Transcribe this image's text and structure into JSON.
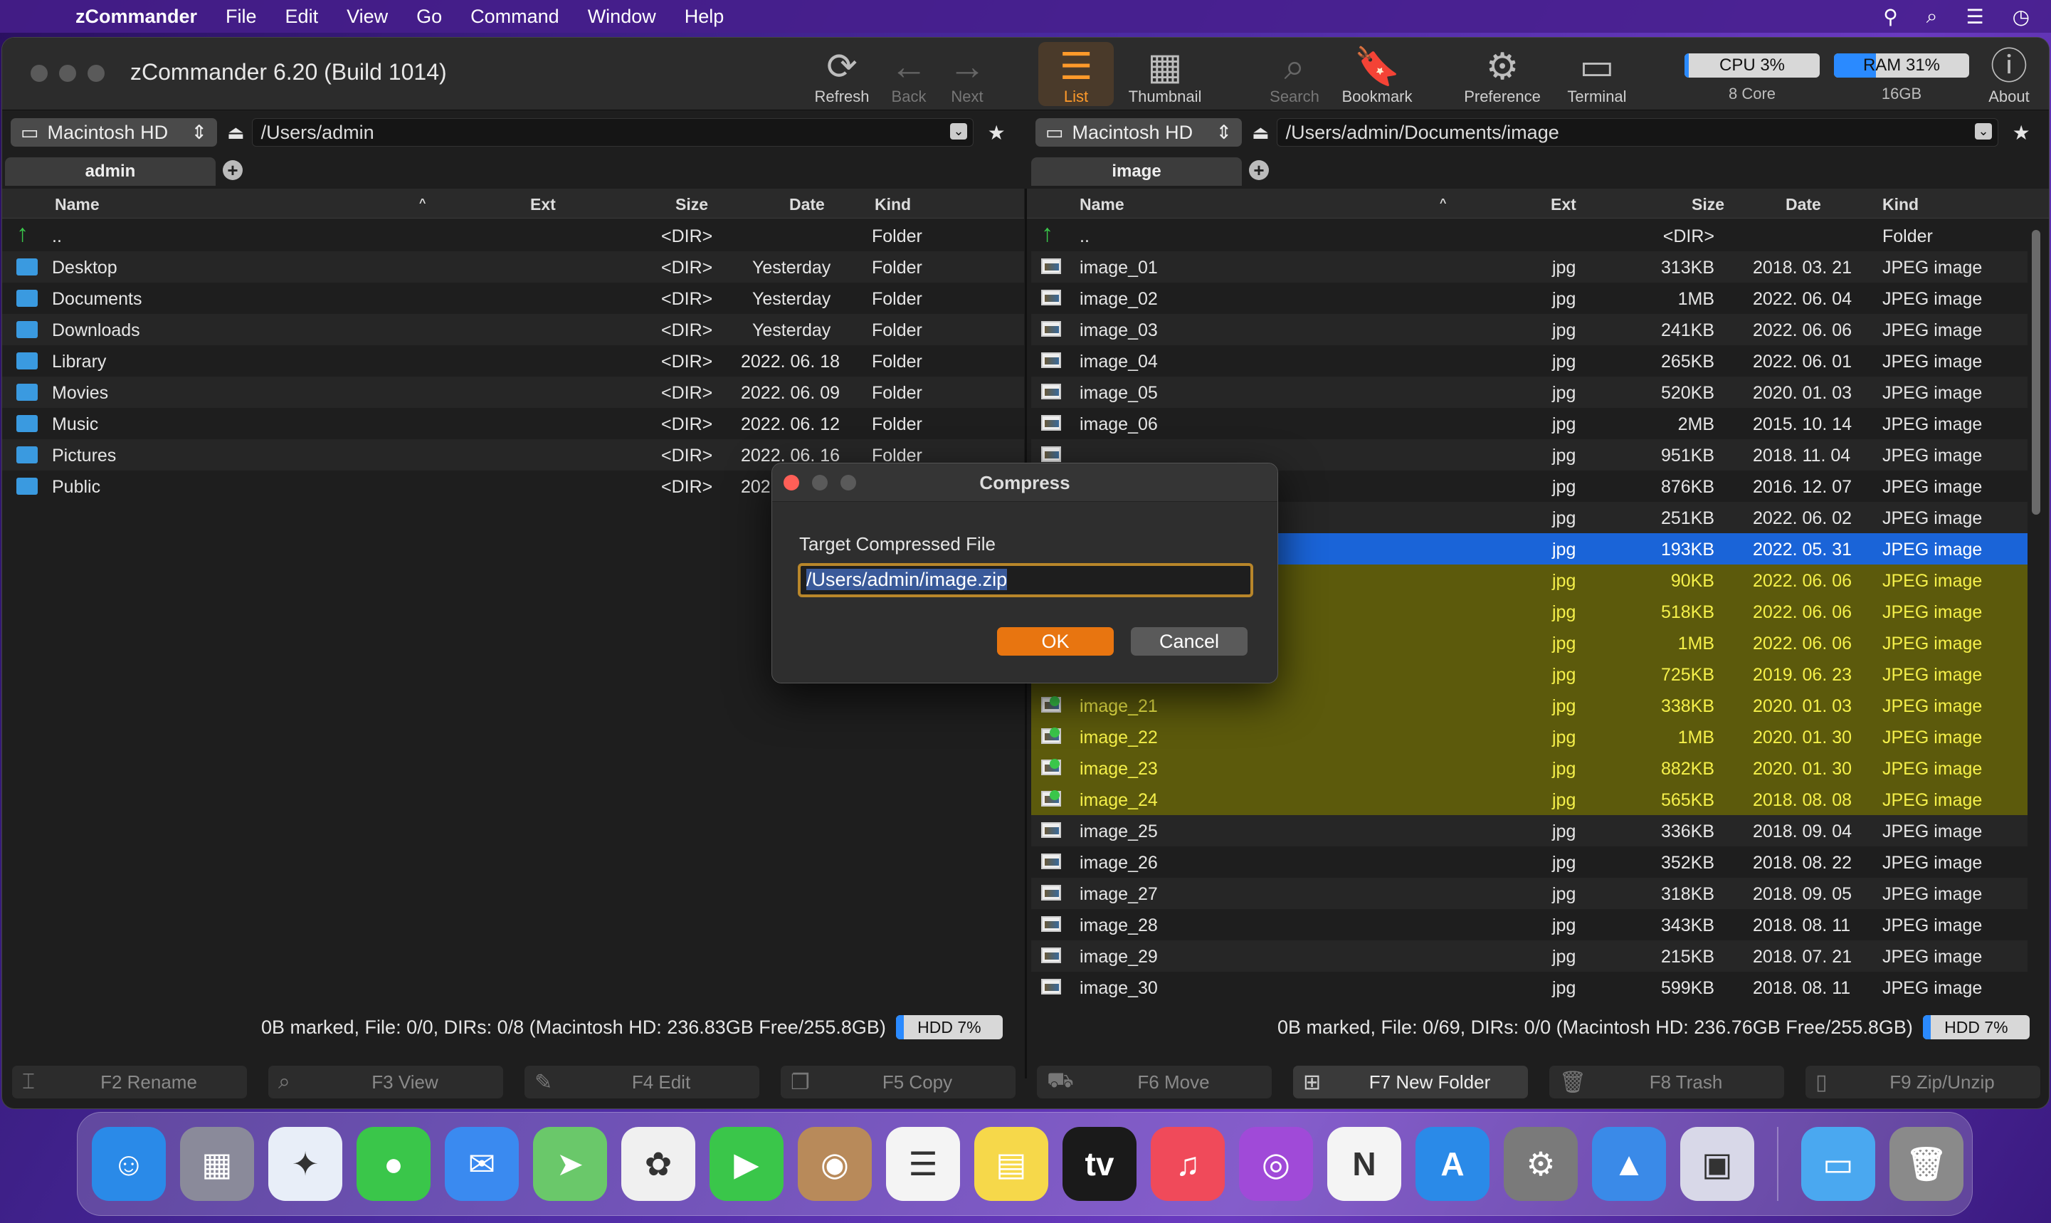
{
  "menubar": {
    "app_name": "zCommander",
    "items": [
      "File",
      "Edit",
      "View",
      "Go",
      "Command",
      "Window",
      "Help"
    ]
  },
  "window": {
    "title": "zCommander 6.20 (Build 1014)"
  },
  "toolbar": {
    "refresh": "Refresh",
    "back": "Back",
    "next": "Next",
    "list": "List",
    "thumbnail": "Thumbnail",
    "search": "Search",
    "bookmark": "Bookmark",
    "preference": "Preference",
    "terminal": "Terminal",
    "about": "About",
    "cpu_label": "CPU 3%",
    "cpu_percent": 3,
    "cpu_sub": "8 Core",
    "ram_label": "RAM 31%",
    "ram_percent": 31,
    "ram_sub": "16GB"
  },
  "left": {
    "volume": "Macintosh HD",
    "path": "/Users/admin",
    "tab": "admin",
    "columns": {
      "name": "Name",
      "ext": "Ext",
      "size": "Size",
      "date": "Date",
      "kind": "Kind"
    },
    "rows": [
      {
        "name": "..",
        "size": "<DIR>",
        "date": "",
        "kind": "Folder",
        "icon": "up-arrow-icon"
      },
      {
        "name": "Desktop",
        "size": "<DIR>",
        "date": "Yesterday",
        "kind": "Folder",
        "icon": "folder-icon"
      },
      {
        "name": "Documents",
        "size": "<DIR>",
        "date": "Yesterday",
        "kind": "Folder",
        "icon": "folder-icon"
      },
      {
        "name": "Downloads",
        "size": "<DIR>",
        "date": "Yesterday",
        "kind": "Folder",
        "icon": "folder-icon"
      },
      {
        "name": "Library",
        "size": "<DIR>",
        "date": "2022. 06. 18",
        "kind": "Folder",
        "icon": "folder-icon"
      },
      {
        "name": "Movies",
        "size": "<DIR>",
        "date": "2022. 06. 09",
        "kind": "Folder",
        "icon": "folder-icon"
      },
      {
        "name": "Music",
        "size": "<DIR>",
        "date": "2022. 06. 12",
        "kind": "Folder",
        "icon": "folder-icon"
      },
      {
        "name": "Pictures",
        "size": "<DIR>",
        "date": "2022. 06. 16",
        "kind": "Folder",
        "icon": "folder-icon"
      },
      {
        "name": "Public",
        "size": "<DIR>",
        "date": "2022",
        "kind": "",
        "icon": "folder-icon"
      }
    ],
    "status": "0B marked, File: 0/0, DIRs: 0/8  (Macintosh HD: 236.83GB Free/255.8GB)",
    "hdd": "HDD 7%"
  },
  "right": {
    "volume": "Macintosh HD",
    "path": "/Users/admin/Documents/image",
    "tab": "image",
    "columns": {
      "name": "Name",
      "ext": "Ext",
      "size": "Size",
      "date": "Date",
      "kind": "Kind"
    },
    "rows": [
      {
        "name": "..",
        "ext": "",
        "size": "<DIR>",
        "date": "",
        "kind": "Folder",
        "state": "up"
      },
      {
        "name": "image_01",
        "ext": "jpg",
        "size": "313KB",
        "date": "2018. 03. 21",
        "kind": "JPEG image",
        "state": ""
      },
      {
        "name": "image_02",
        "ext": "jpg",
        "size": "1MB",
        "date": "2022. 06. 04",
        "kind": "JPEG image",
        "state": ""
      },
      {
        "name": "image_03",
        "ext": "jpg",
        "size": "241KB",
        "date": "2022. 06. 06",
        "kind": "JPEG image",
        "state": ""
      },
      {
        "name": "image_04",
        "ext": "jpg",
        "size": "265KB",
        "date": "2022. 06. 01",
        "kind": "JPEG image",
        "state": ""
      },
      {
        "name": "image_05",
        "ext": "jpg",
        "size": "520KB",
        "date": "2020. 01. 03",
        "kind": "JPEG image",
        "state": ""
      },
      {
        "name": "image_06",
        "ext": "jpg",
        "size": "2MB",
        "date": "2015. 10. 14",
        "kind": "JPEG image",
        "state": ""
      },
      {
        "name": "",
        "ext": "jpg",
        "size": "951KB",
        "date": "2018. 11. 04",
        "kind": "JPEG image",
        "state": ""
      },
      {
        "name": "",
        "ext": "jpg",
        "size": "876KB",
        "date": "2016. 12. 07",
        "kind": "JPEG image",
        "state": ""
      },
      {
        "name": "",
        "ext": "jpg",
        "size": "251KB",
        "date": "2022. 06. 02",
        "kind": "JPEG image",
        "state": ""
      },
      {
        "name": "",
        "ext": "jpg",
        "size": "193KB",
        "date": "2022. 05. 31",
        "kind": "JPEG image",
        "state": "selected"
      },
      {
        "name": "",
        "ext": "jpg",
        "size": "90KB",
        "date": "2022. 06. 06",
        "kind": "JPEG image",
        "state": "marked"
      },
      {
        "name": "",
        "ext": "jpg",
        "size": "518KB",
        "date": "2022. 06. 06",
        "kind": "JPEG image",
        "state": "marked"
      },
      {
        "name": "",
        "ext": "jpg",
        "size": "1MB",
        "date": "2022. 06. 06",
        "kind": "JPEG image",
        "state": "marked"
      },
      {
        "name": "",
        "ext": "jpg",
        "size": "725KB",
        "date": "2019. 06. 23",
        "kind": "JPEG image",
        "state": "marked"
      },
      {
        "name": "image_21",
        "ext": "jpg",
        "size": "338KB",
        "date": "2020. 01. 03",
        "kind": "JPEG image",
        "state": "marked"
      },
      {
        "name": "image_22",
        "ext": "jpg",
        "size": "1MB",
        "date": "2020. 01. 30",
        "kind": "JPEG image",
        "state": "marked"
      },
      {
        "name": "image_23",
        "ext": "jpg",
        "size": "882KB",
        "date": "2020. 01. 30",
        "kind": "JPEG image",
        "state": "marked"
      },
      {
        "name": "image_24",
        "ext": "jpg",
        "size": "565KB",
        "date": "2018. 08. 08",
        "kind": "JPEG image",
        "state": "marked"
      },
      {
        "name": "image_25",
        "ext": "jpg",
        "size": "336KB",
        "date": "2018. 09. 04",
        "kind": "JPEG image",
        "state": ""
      },
      {
        "name": "image_26",
        "ext": "jpg",
        "size": "352KB",
        "date": "2018. 08. 22",
        "kind": "JPEG image",
        "state": ""
      },
      {
        "name": "image_27",
        "ext": "jpg",
        "size": "318KB",
        "date": "2018. 09. 05",
        "kind": "JPEG image",
        "state": ""
      },
      {
        "name": "image_28",
        "ext": "jpg",
        "size": "343KB",
        "date": "2018. 08. 11",
        "kind": "JPEG image",
        "state": ""
      },
      {
        "name": "image_29",
        "ext": "jpg",
        "size": "215KB",
        "date": "2018. 07. 21",
        "kind": "JPEG image",
        "state": ""
      },
      {
        "name": "image_30",
        "ext": "jpg",
        "size": "599KB",
        "date": "2018. 08. 11",
        "kind": "JPEG image",
        "state": ""
      }
    ],
    "status": "0B marked, File: 0/69, DIRs: 0/0  (Macintosh HD: 236.76GB Free/255.8GB)",
    "hdd": "HDD 7%"
  },
  "fkeys": [
    "F2 Rename",
    "F3 View",
    "F4 Edit",
    "F5 Copy",
    "F6 Move",
    "F7 New Folder",
    "F8 Trash",
    "F9 Zip/Unzip"
  ],
  "dialog": {
    "title": "Compress",
    "label": "Target Compressed File",
    "value": "/Users/admin/image.zip",
    "ok": "OK",
    "cancel": "Cancel"
  },
  "dock": {
    "apps": [
      {
        "name": "finder",
        "color": "#2a8ae8",
        "glyph": "☺"
      },
      {
        "name": "launchpad",
        "color": "#8a8a9a",
        "glyph": "▦"
      },
      {
        "name": "safari",
        "color": "#e8eef8",
        "glyph": "✦"
      },
      {
        "name": "messages",
        "color": "#3ac64a",
        "glyph": "●"
      },
      {
        "name": "mail",
        "color": "#3a8af0",
        "glyph": "✉"
      },
      {
        "name": "maps",
        "color": "#6ac86a",
        "glyph": "➤"
      },
      {
        "name": "photos",
        "color": "#f0f0f0",
        "glyph": "✿"
      },
      {
        "name": "facetime",
        "color": "#3ac64a",
        "glyph": "▶"
      },
      {
        "name": "contacts",
        "color": "#b88a5a",
        "glyph": "◉"
      },
      {
        "name": "reminders",
        "color": "#f4f4f4",
        "glyph": "☰"
      },
      {
        "name": "notes",
        "color": "#f6d84a",
        "glyph": "▤"
      },
      {
        "name": "tv",
        "color": "#1a1a1a",
        "glyph": "tv"
      },
      {
        "name": "music",
        "color": "#f04a5a",
        "glyph": "♫"
      },
      {
        "name": "podcasts",
        "color": "#a04ad8",
        "glyph": "◎"
      },
      {
        "name": "news",
        "color": "#f4f4f4",
        "glyph": "N"
      },
      {
        "name": "app-store",
        "color": "#2a8ae8",
        "glyph": "A"
      },
      {
        "name": "system-preferences",
        "color": "#7a7a7a",
        "glyph": "⚙"
      },
      {
        "name": "zcommander",
        "color": "#3a8ae8",
        "glyph": "▲"
      },
      {
        "name": "save-app",
        "color": "#d8d8e8",
        "glyph": "▣"
      }
    ],
    "extras": [
      {
        "name": "downloads-folder",
        "color": "#4aa8f0",
        "glyph": "▭"
      },
      {
        "name": "trash",
        "color": "#8a8a8a",
        "glyph": "🗑"
      }
    ]
  }
}
